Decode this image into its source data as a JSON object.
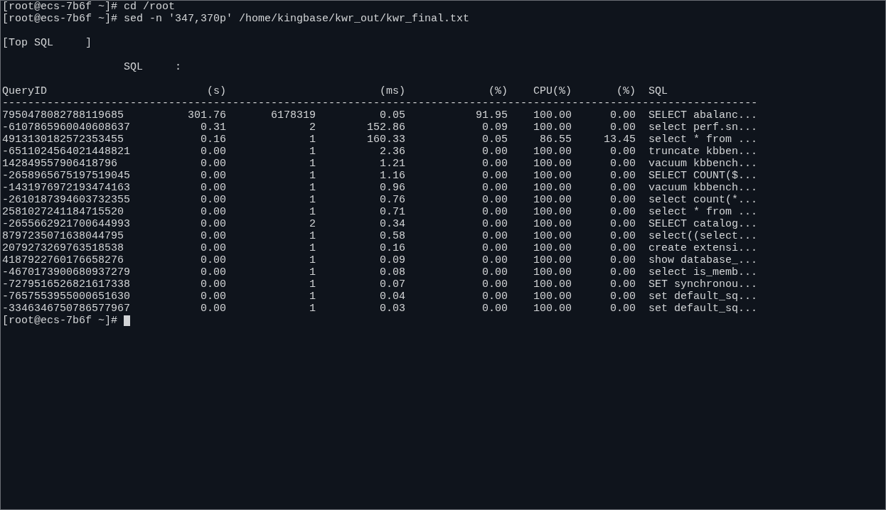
{
  "history": [
    {
      "prompt": "[root@ecs-7b6f ~]#",
      "command": "cd /root"
    },
    {
      "prompt": "[root@ecs-7b6f ~]#",
      "command": "sed -n '347,370p' /home/kingbase/kwr_out/kwr_final.txt"
    }
  ],
  "report": {
    "title": "[Top SQL     ]",
    "subtitle": "SQL     :",
    "columns": [
      {
        "header": "QueryID",
        "kind": "text"
      },
      {
        "header": "(s)",
        "kind": "number"
      },
      {
        "kind": "number"
      },
      {
        "header": "(ms)",
        "kind": "number"
      },
      {
        "header": "(%)",
        "kind": "number"
      },
      {
        "header": "CPU(%)",
        "kind": "number"
      },
      {
        "header": "(%)",
        "kind": "number"
      },
      {
        "header": "SQL",
        "kind": "text"
      }
    ],
    "separator": "----------------------------------------------------------------------------------------------------------------------",
    "rows": [
      [
        "7950478082788119685",
        "301.76",
        "6178319",
        "0.05",
        "91.95",
        "100.00",
        "0.00",
        "SELECT abalanc..."
      ],
      [
        "-6107865960040608637",
        "0.31",
        "2",
        "152.86",
        "0.09",
        "100.00",
        "0.00",
        "select perf.sn..."
      ],
      [
        "4913130182572353455",
        "0.16",
        "1",
        "160.33",
        "0.05",
        "86.55",
        "13.45",
        "select * from ..."
      ],
      [
        "-6511024564021448821",
        "0.00",
        "1",
        "2.36",
        "0.00",
        "100.00",
        "0.00",
        "truncate kbben..."
      ],
      [
        "142849557906418796",
        "0.00",
        "1",
        "1.21",
        "0.00",
        "100.00",
        "0.00",
        "vacuum kbbench..."
      ],
      [
        "-2658965675197519045",
        "0.00",
        "1",
        "1.16",
        "0.00",
        "100.00",
        "0.00",
        "SELECT COUNT($..."
      ],
      [
        "-1431976972193474163",
        "0.00",
        "1",
        "0.96",
        "0.00",
        "100.00",
        "0.00",
        "vacuum kbbench..."
      ],
      [
        "-2610187394603732355",
        "0.00",
        "1",
        "0.76",
        "0.00",
        "100.00",
        "0.00",
        "select count(*..."
      ],
      [
        "2581027241184715520",
        "0.00",
        "1",
        "0.71",
        "0.00",
        "100.00",
        "0.00",
        "select * from ..."
      ],
      [
        "-2655662921700644993",
        "0.00",
        "2",
        "0.34",
        "0.00",
        "100.00",
        "0.00",
        "SELECT catalog..."
      ],
      [
        "8797235071638044795",
        "0.00",
        "1",
        "0.58",
        "0.00",
        "100.00",
        "0.00",
        "select((select..."
      ],
      [
        "2079273269763518538",
        "0.00",
        "1",
        "0.16",
        "0.00",
        "100.00",
        "0.00",
        "create extensi..."
      ],
      [
        "4187922760176658276",
        "0.00",
        "1",
        "0.09",
        "0.00",
        "100.00",
        "0.00",
        "show database_..."
      ],
      [
        "-4670173900680937279",
        "0.00",
        "1",
        "0.08",
        "0.00",
        "100.00",
        "0.00",
        "select is_memb..."
      ],
      [
        "-7279516526821617338",
        "0.00",
        "1",
        "0.07",
        "0.00",
        "100.00",
        "0.00",
        "SET synchronou..."
      ],
      [
        "-7657553955000651630",
        "0.00",
        "1",
        "0.04",
        "0.00",
        "100.00",
        "0.00",
        "set default_sq..."
      ],
      [
        "-3346346750786577967",
        "0.00",
        "1",
        "0.03",
        "0.00",
        "100.00",
        "0.00",
        "set default_sq..."
      ]
    ]
  },
  "current_prompt": {
    "prompt": "[root@ecs-7b6f ~]#",
    "cursor": true
  }
}
